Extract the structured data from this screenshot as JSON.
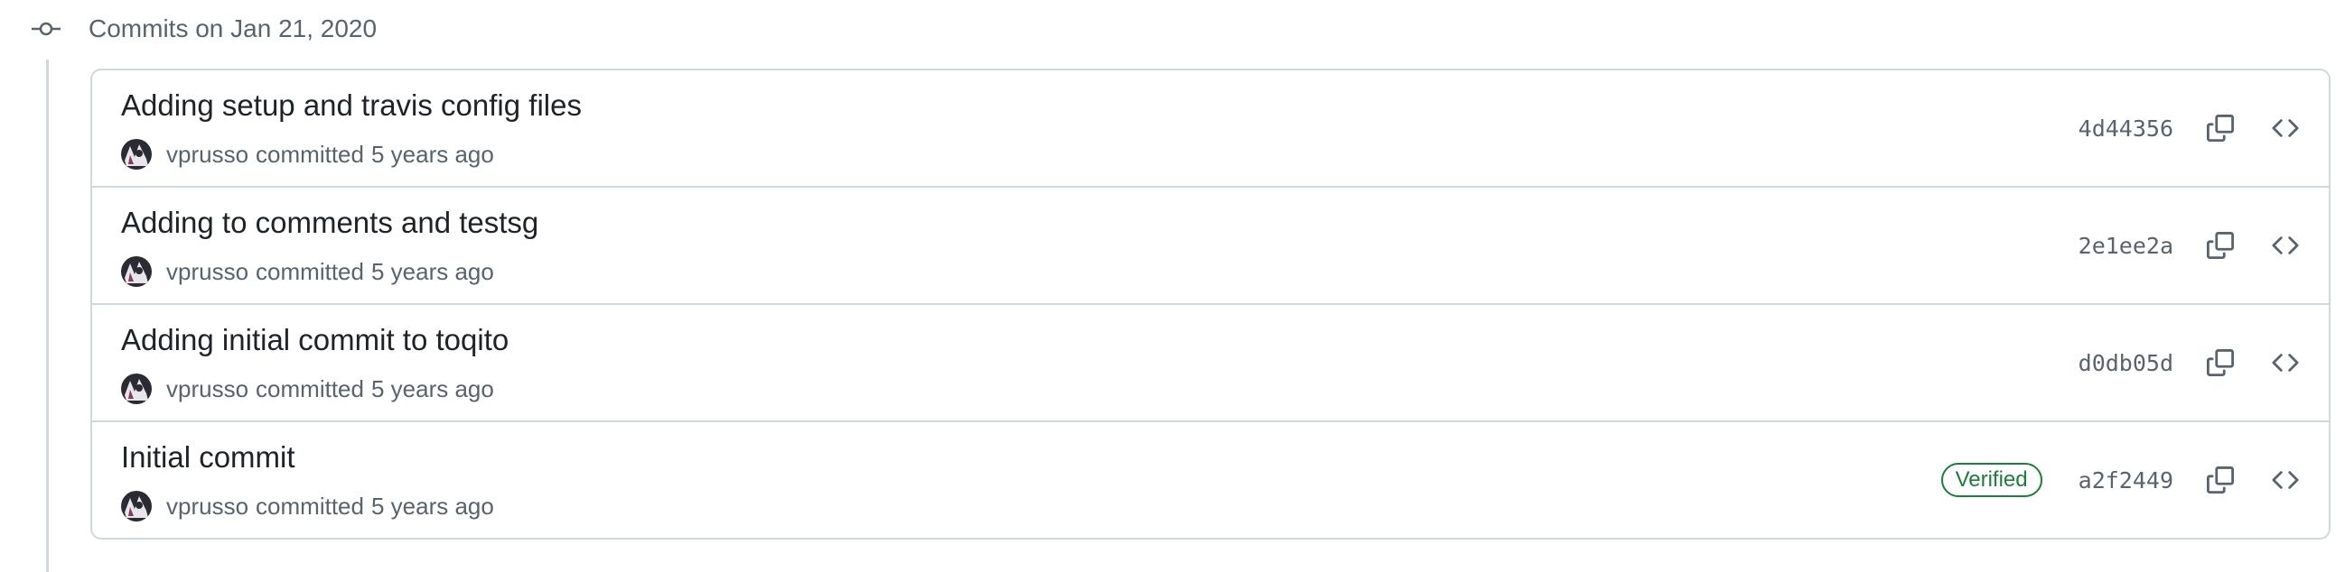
{
  "group": {
    "title": "Commits on Jan 21, 2020"
  },
  "commits": [
    {
      "title": "Adding setup and travis config files",
      "author": "vprusso",
      "action": "committed",
      "time": "5 years ago",
      "sha": "4d44356",
      "badge": ""
    },
    {
      "title": "Adding to comments and testsg",
      "author": "vprusso",
      "action": "committed",
      "time": "5 years ago",
      "sha": "2e1ee2a",
      "badge": ""
    },
    {
      "title": "Adding initial commit to toqito",
      "author": "vprusso",
      "action": "committed",
      "time": "5 years ago",
      "sha": "d0db05d",
      "badge": ""
    },
    {
      "title": "Initial commit",
      "author": "vprusso",
      "action": "committed",
      "time": "5 years ago",
      "sha": "a2f2449",
      "badge": "Verified"
    }
  ],
  "icons": {
    "group": "git-commit-icon",
    "copy": "copy-icon",
    "browse": "code-icon",
    "avatar": "user-avatar"
  },
  "colors": {
    "border": "#d0d7de",
    "muted_text": "#59636e",
    "primary_text": "#1f2328",
    "verified": "#1a7f37"
  }
}
